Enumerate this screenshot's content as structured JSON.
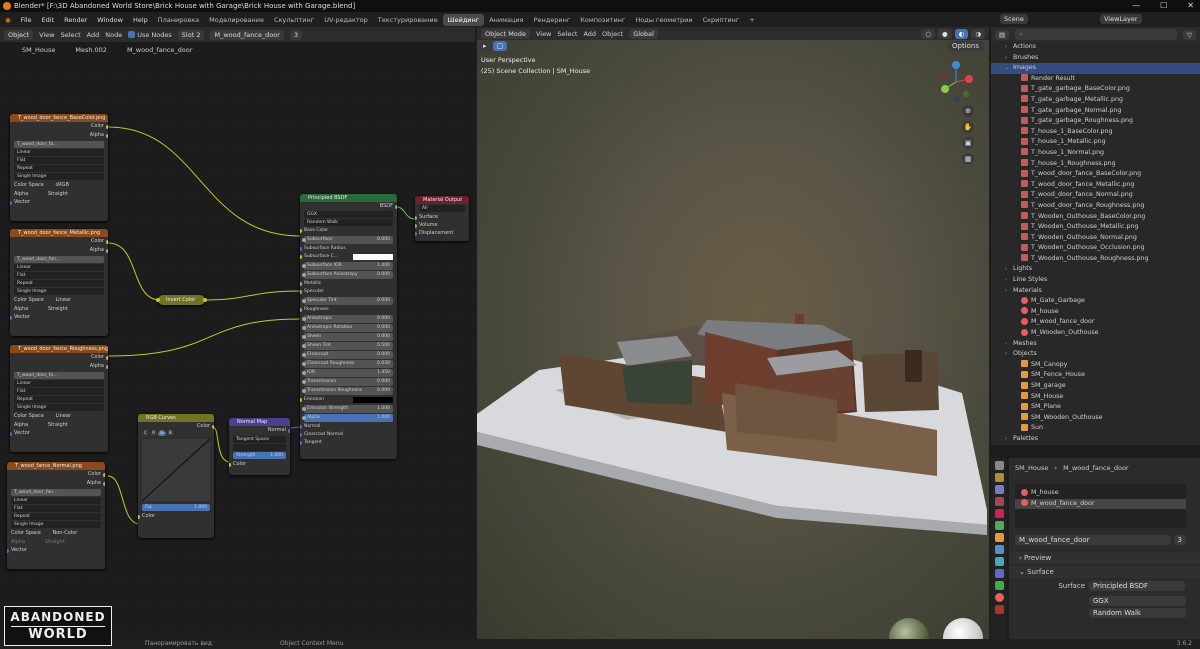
{
  "window": {
    "title": "Blender* [F:\\3D Abandoned World Store\\Brick House with Garage\\Brick House with Garage.blend]",
    "controls": [
      "—",
      "☐",
      "✕"
    ]
  },
  "menu": {
    "items": [
      "File",
      "Edit",
      "Render",
      "Window",
      "Help"
    ],
    "workspaces": [
      "Планировка",
      "Моделирование",
      "Скульптинг",
      "UV-редактор",
      "Текстурирование",
      "Шейдинг",
      "Анимация",
      "Рендеринг",
      "Композитинг",
      "Ноды геометрии",
      "Скриптинг"
    ],
    "active_workspace": "Шейдинг",
    "plus": "+",
    "scene_label": "Scene",
    "view_layer_label": "ViewLayer"
  },
  "node_editor": {
    "header": {
      "mode": "Object",
      "items": [
        "View",
        "Select",
        "Add",
        "Node"
      ],
      "use_nodes": "Use Nodes",
      "slot": "Slot 2",
      "material": "M_wood_fance_door",
      "users": "3"
    },
    "breadcrumb": [
      "SM_House",
      "Mesh.002",
      "M_wood_fance_door"
    ],
    "nodes": {
      "tex1": {
        "title": "T_wood_door_fance_BaseColor.png",
        "outputs": [
          "Color",
          "Alpha"
        ],
        "image": "T_wood_door_fa...",
        "fields": [
          "Linear",
          "Flat",
          "Repeat",
          "Single Image"
        ],
        "cs_label": "Color Space",
        "cs": "sRGB",
        "alpha_label": "Alpha",
        "alpha": "Straight",
        "vector": "Vector"
      },
      "tex2": {
        "title": "T_wood_door_fance_Metallic.png",
        "outputs": [
          "Color",
          "Alpha"
        ],
        "image": "T_wood_door_fan...",
        "fields": [
          "Linear",
          "Flat",
          "Repeat",
          "Single Image"
        ],
        "cs_label": "Color Space",
        "cs": "Linear",
        "alpha_label": "Alpha",
        "alpha": "Straight",
        "vector": "Vector"
      },
      "tex3": {
        "title": "T_wood_door_fance_Roughness.png",
        "outputs": [
          "Color",
          "Alpha"
        ],
        "image": "T_wood_door_fa...",
        "fields": [
          "Linear",
          "Flat",
          "Repeat",
          "Single Image"
        ],
        "cs_label": "Color Space",
        "cs": "Linear",
        "alpha_label": "Alpha",
        "alpha": "Straight",
        "vector": "Vector"
      },
      "tex4": {
        "title": "T_wood_fance_Normal.png",
        "outputs": [
          "Color",
          "Alpha"
        ],
        "image": "T_wood_door_fan...",
        "fields": [
          "Linear",
          "Flat",
          "Repeat",
          "Single Image"
        ],
        "cs_label": "Color Space",
        "cs": "Non-Color",
        "alpha_label": "Alpha",
        "alpha": "Straight",
        "vector": "Vector"
      },
      "invert": {
        "title": "Invert Color"
      },
      "curves": {
        "title": "RGB Curves",
        "out": "Color",
        "tabs": [
          "C",
          "R",
          "G",
          "B"
        ],
        "fac": "Fac",
        "fac_val": "1.000",
        "color_in": "Color"
      },
      "normalmap": {
        "title": "Normal Map",
        "out": "Normal",
        "space": "Tangent Space",
        "strength": "Strength",
        "strength_val": "1.000",
        "color_in": "Color"
      },
      "bsdf": {
        "title": "Principled BSDF",
        "out": "BSDF",
        "dist": "GGX",
        "sss": "Random Walk",
        "rows": [
          [
            "Base Color",
            ""
          ],
          [
            "Subsurface",
            "0.000"
          ],
          [
            "Subsurface Radius",
            ""
          ],
          [
            "Subsurface C...",
            ""
          ],
          [
            "Subsurface IOR",
            "1.400"
          ],
          [
            "Subsurface Anisotropy",
            "0.000"
          ],
          [
            "Metallic",
            ""
          ],
          [
            "Specular",
            ""
          ],
          [
            "Specular Tint",
            "0.000"
          ],
          [
            "Roughness",
            ""
          ],
          [
            "Anisotropic",
            "0.000"
          ],
          [
            "Anisotropic Rotation",
            "0.000"
          ],
          [
            "Sheen",
            "0.000"
          ],
          [
            "Sheen Tint",
            "0.500"
          ],
          [
            "Clearcoat",
            "0.000"
          ],
          [
            "Clearcoat Roughness",
            "0.030"
          ],
          [
            "IOR",
            "1.450"
          ],
          [
            "Transmission",
            "0.000"
          ],
          [
            "Transmission Roughness",
            "0.000"
          ],
          [
            "Emission",
            ""
          ],
          [
            "Emission Strength",
            "1.000"
          ],
          [
            "Alpha",
            "1.000"
          ],
          [
            "Normal",
            ""
          ],
          [
            "Clearcoat Normal",
            ""
          ],
          [
            "Tangent",
            ""
          ]
        ]
      },
      "output": {
        "title": "Material Output",
        "target": "All",
        "inputs": [
          "Surface",
          "Volume",
          "Displacement"
        ]
      }
    }
  },
  "viewport": {
    "header": {
      "mode": "Object Mode",
      "items": [
        "View",
        "Select",
        "Add",
        "Object"
      ],
      "orient": "Global",
      "options": "Options"
    },
    "label1": "User Perspective",
    "label2": "(25) Scene Collection | SM_House",
    "axes": [
      "X",
      "Y",
      "Z"
    ]
  },
  "outliner": {
    "items": [
      {
        "t": "Actions",
        "lvl": 0,
        "icon": "cat"
      },
      {
        "t": "Brushes",
        "lvl": 0,
        "icon": "cat"
      },
      {
        "t": "Images",
        "lvl": 0,
        "icon": "cat",
        "sel": true
      },
      {
        "t": "Render Result",
        "lvl": 1,
        "icon": "img"
      },
      {
        "t": "T_gate_garbage_BaseColor.png",
        "lvl": 1,
        "icon": "img"
      },
      {
        "t": "T_gate_garbage_Metallic.png",
        "lvl": 1,
        "icon": "img"
      },
      {
        "t": "T_gate_garbage_Normal.png",
        "lvl": 1,
        "icon": "img"
      },
      {
        "t": "T_gate_garbage_Roughness.png",
        "lvl": 1,
        "icon": "img"
      },
      {
        "t": "T_house_1_BaseColor.png",
        "lvl": 1,
        "icon": "img"
      },
      {
        "t": "T_house_1_Metallic.png",
        "lvl": 1,
        "icon": "img"
      },
      {
        "t": "T_house_1_Normal.png",
        "lvl": 1,
        "icon": "img"
      },
      {
        "t": "T_house_1_Roughness.png",
        "lvl": 1,
        "icon": "img"
      },
      {
        "t": "T_wood_door_fance_BaseColor.png",
        "lvl": 1,
        "icon": "img"
      },
      {
        "t": "T_wood_door_fance_Metallic.png",
        "lvl": 1,
        "icon": "img"
      },
      {
        "t": "T_wood_door_fance_Normal.png",
        "lvl": 1,
        "icon": "img"
      },
      {
        "t": "T_wood_door_fance_Roughness.png",
        "lvl": 1,
        "icon": "img"
      },
      {
        "t": "T_Wooden_Outhouse_BaseColor.png",
        "lvl": 1,
        "icon": "img"
      },
      {
        "t": "T_Wooden_Outhouse_Metallic.png",
        "lvl": 1,
        "icon": "img"
      },
      {
        "t": "T_Wooden_Outhouse_Normal.png",
        "lvl": 1,
        "icon": "img"
      },
      {
        "t": "T_Wooden_Outhouse_Occlusion.png",
        "lvl": 1,
        "icon": "img"
      },
      {
        "t": "T_Wooden_Outhouse_Roughness.png",
        "lvl": 1,
        "icon": "img"
      },
      {
        "t": "Lights",
        "lvl": 0,
        "icon": "cat"
      },
      {
        "t": "Line Styles",
        "lvl": 0,
        "icon": "cat"
      },
      {
        "t": "Materials",
        "lvl": 0,
        "icon": "cat"
      },
      {
        "t": "M_Gate_Garbage",
        "lvl": 1,
        "icon": "mat"
      },
      {
        "t": "M_house",
        "lvl": 1,
        "icon": "mat"
      },
      {
        "t": "M_wood_fance_door",
        "lvl": 1,
        "icon": "mat"
      },
      {
        "t": "M_Wooden_Outhouse",
        "lvl": 1,
        "icon": "mat"
      },
      {
        "t": "Meshes",
        "lvl": 0,
        "icon": "cat"
      },
      {
        "t": "Objects",
        "lvl": 0,
        "icon": "cat"
      },
      {
        "t": "SM_Canopy",
        "lvl": 1,
        "icon": "obj"
      },
      {
        "t": "SM_Fence_House",
        "lvl": 1,
        "icon": "obj"
      },
      {
        "t": "SM_garage",
        "lvl": 1,
        "icon": "obj"
      },
      {
        "t": "SM_House",
        "lvl": 1,
        "icon": "obj"
      },
      {
        "t": "SM_Plane",
        "lvl": 1,
        "icon": "obj"
      },
      {
        "t": "SM_Wooden_Outhouse",
        "lvl": 1,
        "icon": "obj"
      },
      {
        "t": "Sun",
        "lvl": 1,
        "icon": "obj"
      },
      {
        "t": "Palettes",
        "lvl": 0,
        "icon": "cat"
      }
    ]
  },
  "properties": {
    "breadcrumb": [
      "SM_House",
      "M_wood_fance_door"
    ],
    "slots": [
      "M_house",
      "M_wood_fance_door"
    ],
    "material": "M_wood_fance_door",
    "users": "3",
    "preview": "Preview",
    "surface_panel": "Surface",
    "surface_label": "Surface",
    "surface_val": "Principled BSDF",
    "dist": "GGX",
    "sss": "Random Walk"
  },
  "status": {
    "pan": "Панорамировать вид",
    "ctx": "Object Context Menu",
    "version": "3.6.2"
  },
  "logo": {
    "line1": "ABANDONED",
    "line2": "WORLD"
  }
}
